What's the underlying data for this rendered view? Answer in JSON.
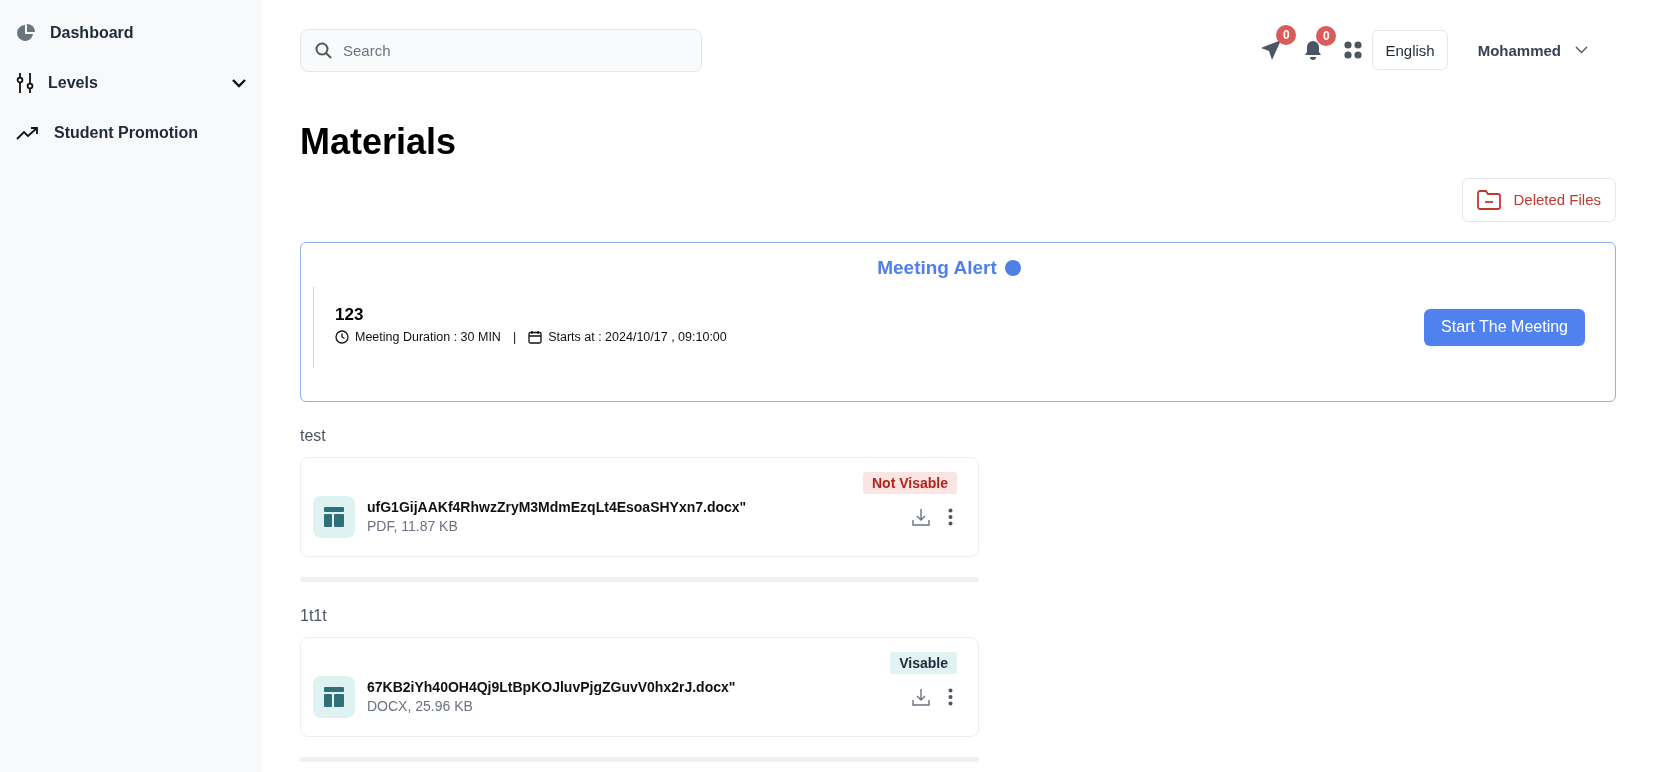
{
  "sidebar": {
    "items": [
      {
        "kind": "link",
        "label": "Dashboard"
      },
      {
        "kind": "group",
        "label": "Levels",
        "expanded": false
      },
      {
        "kind": "link",
        "label": "Student Promotion"
      }
    ]
  },
  "header": {
    "search": {
      "placeholder": "Search"
    },
    "messages_badge": "0",
    "notifications_badge": "0",
    "language": "English",
    "user": "Mohammed"
  },
  "page_title": "Materials",
  "deleted_files_button": "Deleted Files",
  "meeting_alert": {
    "title": "Meeting Alert",
    "name": "123",
    "duration": "Meeting Duration : 30 MIN",
    "separator": "|",
    "starts": "Starts at : 2024/10/17 , 09:10:00",
    "button": "Start The Meeting"
  },
  "sections": [
    {
      "title": "test",
      "files": [
        {
          "name": "ufG1GijAAKf4RhwzZryM3MdmEzqLt4EsoaSHYxn7.docx\"",
          "meta": "PDF, 11.87 KB",
          "status": "Not Visable",
          "visible": false
        }
      ]
    },
    {
      "title": "1t1t",
      "files": [
        {
          "name": "67KB2iYh40OH4Qj9LtBpKOJluvPjgZGuvV0hx2rJ.docx\"",
          "meta": "DOCX, 25.96 KB",
          "status": "Visable",
          "visible": true
        }
      ]
    }
  ]
}
